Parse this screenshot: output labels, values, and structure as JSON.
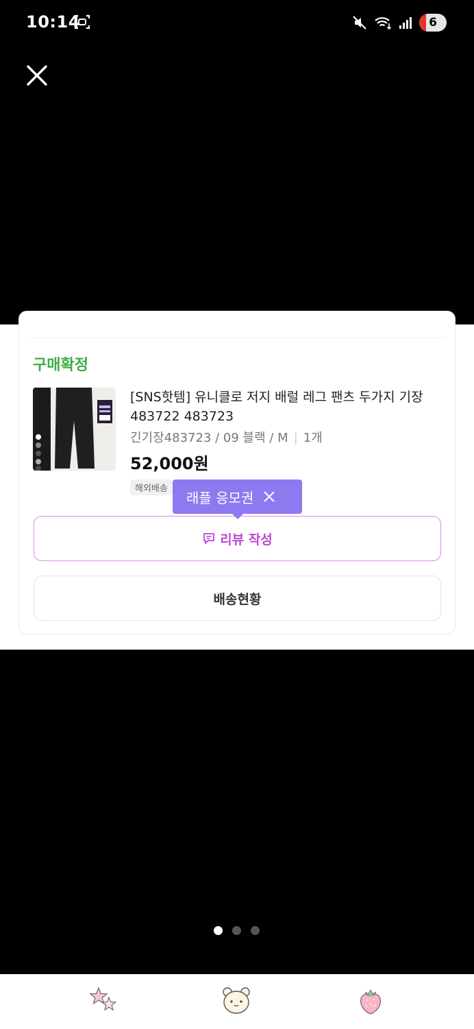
{
  "status_bar": {
    "time": "10:14",
    "battery_level": "6",
    "icons": [
      "screenshot-icon",
      "mute-icon",
      "wifi-icon",
      "signal-icon"
    ]
  },
  "order": {
    "status": "구매확정",
    "product_name": "[SNS핫템] 유니클로 저지 배럴 레그 팬츠 두가지 기장 483722 483723",
    "option": "긴기장483723 / 09 블랙 / M",
    "quantity": "1개",
    "price": "52,000원",
    "shipping_tag": "해외배송"
  },
  "tooltip": {
    "label": "래플 응모권"
  },
  "buttons": {
    "review": "리뷰 작성",
    "delivery": "배송현황"
  },
  "pagination": {
    "total": 3,
    "current": 1
  },
  "bottom_nav": [
    "stars-icon",
    "bear-icon",
    "strawberry-icon"
  ],
  "colors": {
    "status_green": "#3dae45",
    "review_purple": "#c044d7",
    "tooltip_bg": "#8e79f1"
  }
}
